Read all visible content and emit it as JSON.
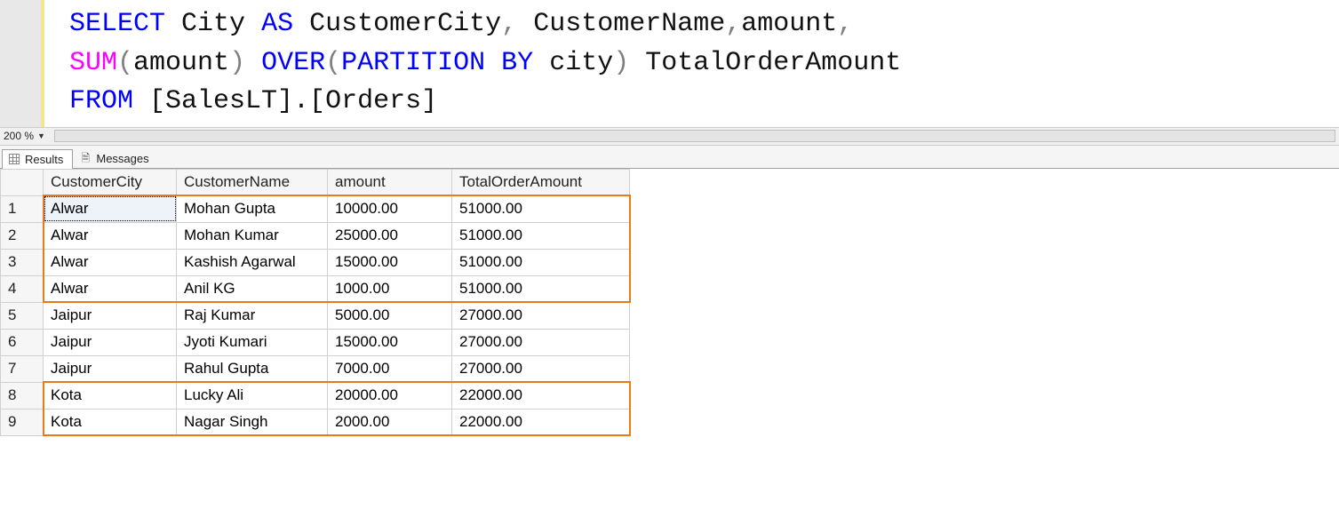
{
  "sql": {
    "line1": {
      "select": "SELECT",
      "city": "City",
      "as": "AS",
      "alias1": "CustomerCity",
      "comma1": ",",
      "custname": "CustomerName",
      "comma2": ",",
      "amount": "amount",
      "comma3": ","
    },
    "line2": {
      "sum": "SUM",
      "lp1": "(",
      "amount": "amount",
      "rp1": ")",
      "over": "OVER",
      "lp2": "(",
      "partitionby": "PARTITION BY",
      "city": "city",
      "rp2": ")",
      "alias": "TotalOrderAmount"
    },
    "line3": {
      "from": "FROM",
      "obj": "[SalesLT].[Orders]"
    }
  },
  "zoom": {
    "value": "200 %"
  },
  "tabs": {
    "results": "Results",
    "messages": "Messages"
  },
  "grid": {
    "headers": [
      "CustomerCity",
      "CustomerName",
      "amount",
      "TotalOrderAmount"
    ],
    "rows": [
      {
        "n": "1",
        "CustomerCity": "Alwar",
        "CustomerName": "Mohan Gupta",
        "amount": "10000.00",
        "TotalOrderAmount": "51000.00"
      },
      {
        "n": "2",
        "CustomerCity": "Alwar",
        "CustomerName": "Mohan Kumar",
        "amount": "25000.00",
        "TotalOrderAmount": "51000.00"
      },
      {
        "n": "3",
        "CustomerCity": "Alwar",
        "CustomerName": "Kashish Agarwal",
        "amount": "15000.00",
        "TotalOrderAmount": "51000.00"
      },
      {
        "n": "4",
        "CustomerCity": "Alwar",
        "CustomerName": "Anil KG",
        "amount": "1000.00",
        "TotalOrderAmount": "51000.00"
      },
      {
        "n": "5",
        "CustomerCity": "Jaipur",
        "CustomerName": "Raj Kumar",
        "amount": "5000.00",
        "TotalOrderAmount": "27000.00"
      },
      {
        "n": "6",
        "CustomerCity": "Jaipur",
        "CustomerName": "Jyoti Kumari",
        "amount": "15000.00",
        "TotalOrderAmount": "27000.00"
      },
      {
        "n": "7",
        "CustomerCity": "Jaipur",
        "CustomerName": "Rahul Gupta",
        "amount": "7000.00",
        "TotalOrderAmount": "27000.00"
      },
      {
        "n": "8",
        "CustomerCity": "Kota",
        "CustomerName": "Lucky Ali",
        "amount": "20000.00",
        "TotalOrderAmount": "22000.00"
      },
      {
        "n": "9",
        "CustomerCity": "Kota",
        "CustomerName": "Nagar Singh",
        "amount": "2000.00",
        "TotalOrderAmount": "22000.00"
      }
    ]
  }
}
